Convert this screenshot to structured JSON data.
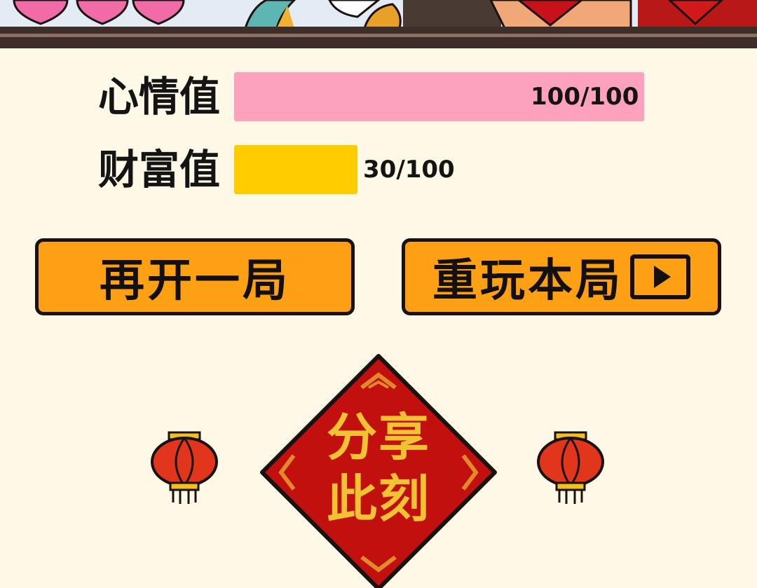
{
  "stats": {
    "mood": {
      "label": "心情值",
      "value": 100,
      "max": 100,
      "text": "100/100",
      "color": "#FCA1BE"
    },
    "wealth": {
      "label": "财富值",
      "value": 30,
      "max": 100,
      "text": "30/100",
      "color": "#FFCC00"
    }
  },
  "buttons": {
    "new_game": "再开一局",
    "replay": "重玩本局",
    "replay_icon": "video-play-icon"
  },
  "share": {
    "line1": "分享",
    "line2": "此刻",
    "color": "#C2100F",
    "text_color": "#F1C232"
  },
  "decor": {
    "lantern_icon": "lantern-icon",
    "heart_icon": "heart-icon"
  }
}
